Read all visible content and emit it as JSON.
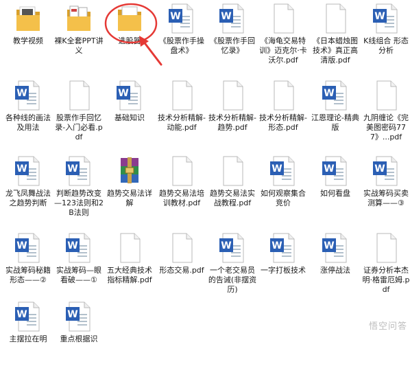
{
  "files": [
    {
      "type": "folder-media",
      "label": "教学视频"
    },
    {
      "type": "folder-docs",
      "label": "裸K全套PPT讲义"
    },
    {
      "type": "folder-plain",
      "label": "选股器"
    },
    {
      "type": "word",
      "label": "《股票作手操盘术》"
    },
    {
      "type": "word",
      "label": "《股票作手回忆录》"
    },
    {
      "type": "blank",
      "label": "《海龟交易特训》迈克尔·卡沃尔.pdf"
    },
    {
      "type": "blank",
      "label": "《日本蜡烛图技术》真正高清版.pdf"
    },
    {
      "type": "word",
      "label": "K线组合 形态分析"
    },
    {
      "type": "word",
      "label": "各种线的画法及用法"
    },
    {
      "type": "blank",
      "label": "股票作手回忆录-入门必看.pdf"
    },
    {
      "type": "word",
      "label": "基础知识"
    },
    {
      "type": "blank",
      "label": "技术分析精解-动能.pdf"
    },
    {
      "type": "blank",
      "label": "技术分析精解-趋势.pdf"
    },
    {
      "type": "blank",
      "label": "技术分析精解-形态.pdf"
    },
    {
      "type": "word",
      "label": "江恩理论-精典版"
    },
    {
      "type": "blank",
      "label": "九阴缠论《完美图密码777》...pdf"
    },
    {
      "type": "word",
      "label": "龙飞凤舞战法之趋势判断"
    },
    {
      "type": "word",
      "label": "判断趋势改变—123法则和2B法则"
    },
    {
      "type": "rar",
      "label": "趋势交易法详解"
    },
    {
      "type": "blank",
      "label": "趋势交易法培训教材.pdf"
    },
    {
      "type": "blank",
      "label": "趋势交易法实战教程.pdf"
    },
    {
      "type": "word",
      "label": "如何观察集合竞价"
    },
    {
      "type": "word",
      "label": "如何看盘"
    },
    {
      "type": "word",
      "label": "实战筹码买卖测算——③"
    },
    {
      "type": "word",
      "label": "实战筹码秘籍形态——②"
    },
    {
      "type": "word",
      "label": "实战筹码—眼看破——①"
    },
    {
      "type": "blank",
      "label": "五大经典技术指标精解.pdf"
    },
    {
      "type": "blank",
      "label": "形态交易.pdf"
    },
    {
      "type": "word",
      "label": "一个老交易员的告诫(非摆资历)"
    },
    {
      "type": "word",
      "label": "一字打板技术"
    },
    {
      "type": "word",
      "label": "涨停战法"
    },
    {
      "type": "blank",
      "label": "证券分析本杰明·格雷厄姆.pdf"
    },
    {
      "type": "word",
      "label": "主摆拉在明"
    },
    {
      "type": "word",
      "label": "重点根据识"
    }
  ],
  "annotation": {
    "circle_color": "#e53935",
    "arrow_color": "#e53935"
  },
  "colors": {
    "folder": "#f4c04a",
    "folder_dark": "#d9a02a",
    "word_blue": "#2b5fb4",
    "paper": "#ffffff",
    "paper_border": "#b9b9b9"
  },
  "watermark": "悟空问答"
}
